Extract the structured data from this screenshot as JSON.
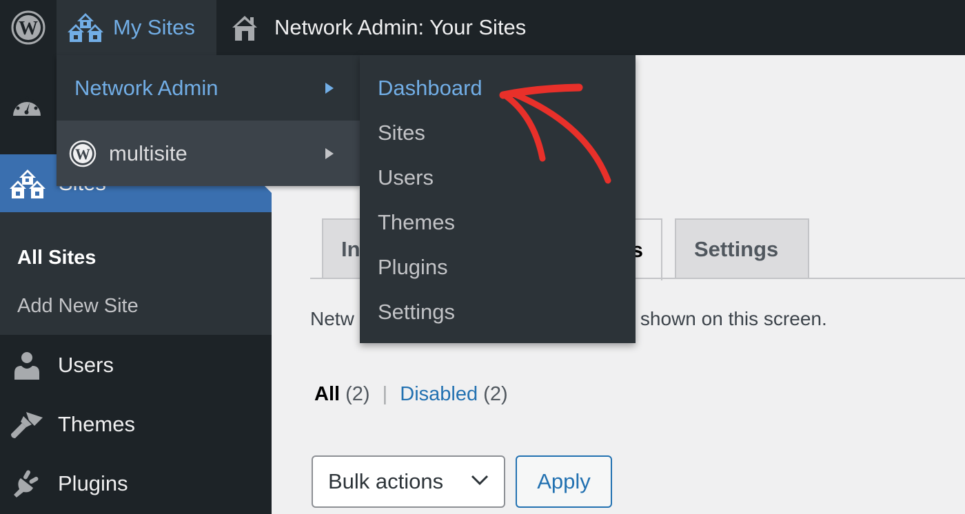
{
  "adminbar": {
    "my_sites_label": "My Sites",
    "network_label": "Network Admin: Your Sites"
  },
  "sidebar": {
    "sites_label": "Sites",
    "submenu": [
      "All Sites",
      "Add New Site"
    ],
    "items": [
      {
        "label": "Users",
        "icon": "user-icon"
      },
      {
        "label": "Themes",
        "icon": "brush-icon"
      },
      {
        "label": "Plugins",
        "icon": "plugin-icon"
      }
    ]
  },
  "my_sites_menu": {
    "items": [
      {
        "label": "Network Admin"
      },
      {
        "label": "multisite"
      }
    ]
  },
  "network_admin_submenu": {
    "items": [
      "Dashboard",
      "Sites",
      "Users",
      "Themes",
      "Plugins",
      "Settings"
    ]
  },
  "main": {
    "tabs": [
      {
        "label": "In"
      },
      {
        "label": "s"
      },
      {
        "label": "Settings"
      }
    ],
    "notice_left": "Netw",
    "notice_right": "ot shown on this screen.",
    "filters": {
      "all_label": "All",
      "all_count": "(2)",
      "separator": "|",
      "disabled_label": "Disabled",
      "disabled_count": "(2)"
    },
    "bulk_actions": "Bulk actions",
    "apply_label": "Apply"
  },
  "colors": {
    "accent_blue": "#72aee6",
    "link_blue": "#2271b1",
    "annotation_red": "#e8302a"
  }
}
